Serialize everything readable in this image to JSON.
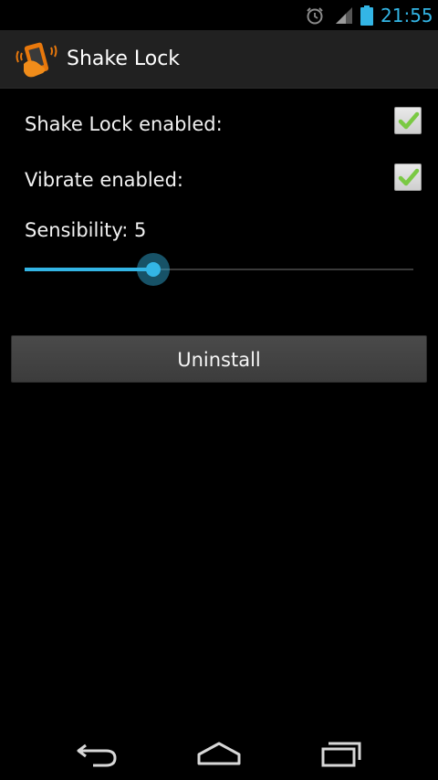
{
  "status_bar": {
    "time": "21:55",
    "icons": [
      "alarm-icon",
      "signal-icon",
      "battery-icon"
    ],
    "accent_color": "#33b5e5"
  },
  "action_bar": {
    "title": "Shake Lock",
    "icon": "shake-lock-app-icon"
  },
  "settings": {
    "shake_lock_label": "Shake Lock enabled:",
    "shake_lock_checked": true,
    "vibrate_label": "Vibrate enabled:",
    "vibrate_checked": true,
    "sensibility_label": "Sensibility: 5",
    "sensibility_fraction": 0.33
  },
  "actions": {
    "uninstall_label": "Uninstall"
  },
  "nav_bar": {
    "icons": [
      "back-icon",
      "home-icon",
      "recent-apps-icon"
    ]
  }
}
